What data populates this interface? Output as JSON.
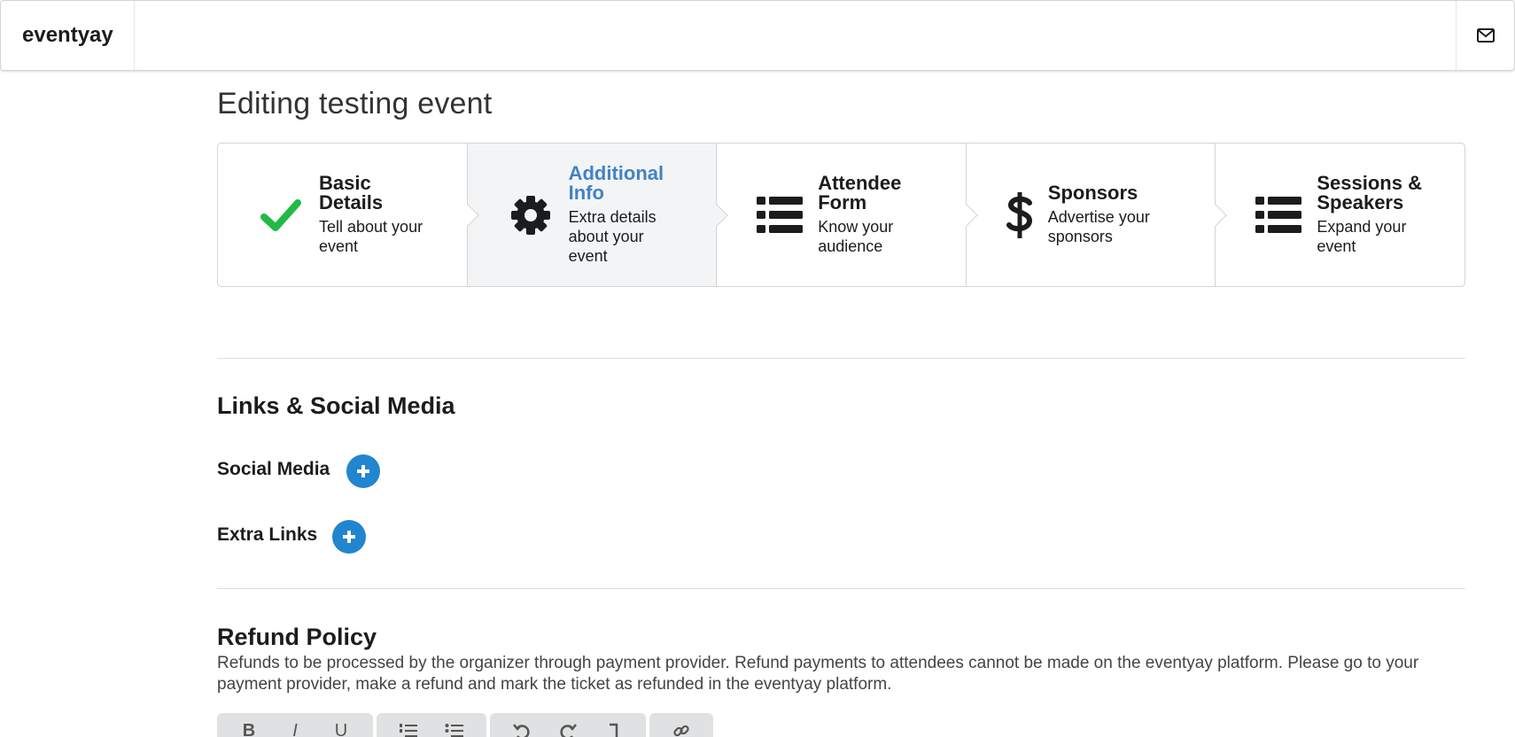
{
  "app": {
    "brand": "eventyay",
    "mail_icon": "mail-icon"
  },
  "page": {
    "title": "Editing testing event"
  },
  "steps": [
    {
      "title": "Basic Details",
      "title_lines": [
        "Basic",
        "Details"
      ],
      "desc_lines": [
        "Tell about your",
        "event"
      ],
      "icon": "check-icon",
      "state": "completed"
    },
    {
      "title": "Additional Info",
      "title_lines": [
        "Additional",
        "Info"
      ],
      "desc_lines": [
        "Extra details",
        "about your",
        "event"
      ],
      "icon": "gear-icon",
      "state": "active"
    },
    {
      "title": "Attendee Form",
      "title_lines": [
        "Attendee",
        "Form"
      ],
      "desc_lines": [
        "Know your",
        "audience"
      ],
      "icon": "list-icon",
      "state": "pending"
    },
    {
      "title": "Sponsors",
      "title_lines": [
        "Sponsors"
      ],
      "desc_lines": [
        "Advertise your",
        "sponsors"
      ],
      "icon": "dollar-icon",
      "state": "pending"
    },
    {
      "title": "Sessions & Speakers",
      "title_lines": [
        "Sessions &",
        "Speakers"
      ],
      "desc_lines": [
        "Expand your",
        "event"
      ],
      "icon": "list-icon",
      "state": "pending"
    }
  ],
  "links_section": {
    "title": "Links & Social Media",
    "social_media_label": "Social Media",
    "extra_links_label": "Extra Links"
  },
  "refund": {
    "title": "Refund Policy",
    "text": "Refunds to be processed by the organizer through payment provider. Refund payments to attendees cannot be made on the eventyay platform. Please go to your payment provider, make a refund and mark the ticket as refunded in the eventyay platform."
  },
  "editor_toolbar": {
    "groups": [
      [
        "B",
        "I",
        "U"
      ],
      [
        "ordered-list-icon",
        "unordered-list-icon"
      ],
      [
        "undo-icon",
        "redo-icon",
        "remove-format-icon"
      ],
      [
        "link-icon"
      ]
    ],
    "bold": "B",
    "italic": "I",
    "underline": "U"
  },
  "colors": {
    "check": "#21ba45",
    "active_title": "#4183c4",
    "add_button": "#2185d0",
    "active_step_bg": "#f3f4f5"
  }
}
